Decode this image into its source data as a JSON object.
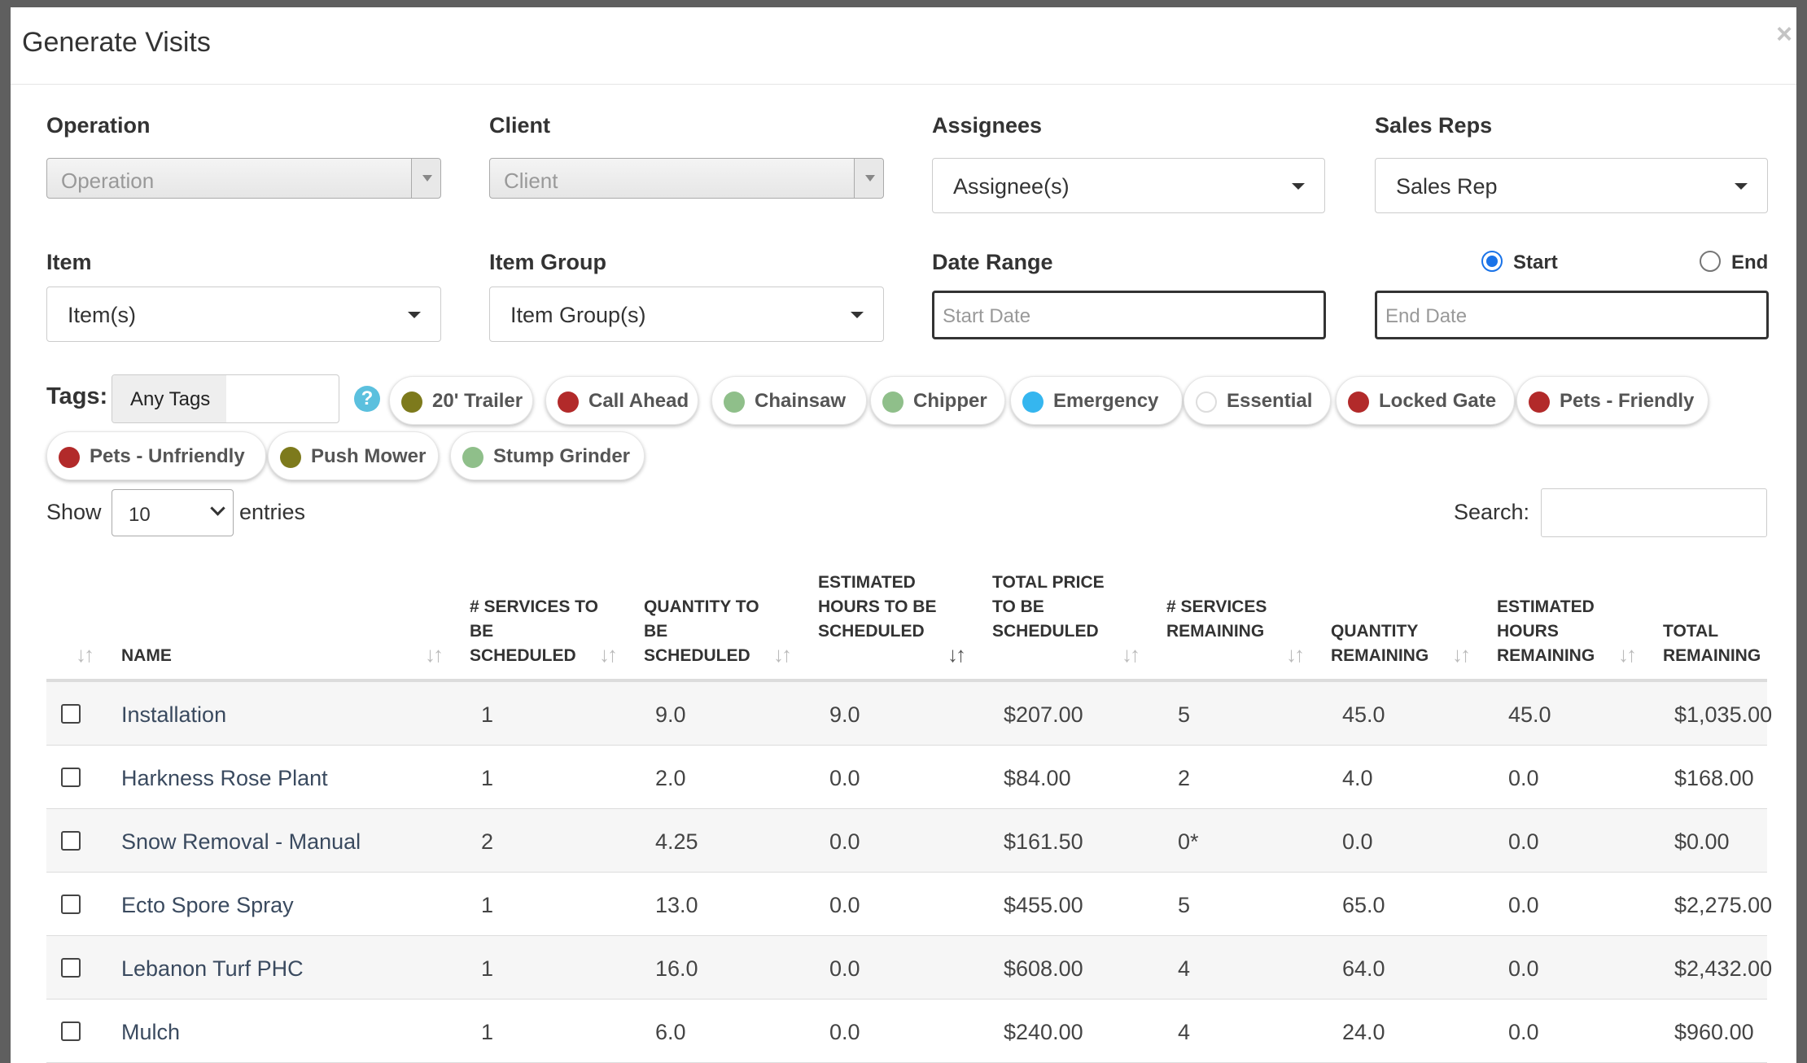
{
  "modal": {
    "title": "Generate Visits",
    "close_glyph": "×"
  },
  "filters": {
    "operation": {
      "label": "Operation",
      "placeholder": "Operation"
    },
    "client": {
      "label": "Client",
      "placeholder": "Client"
    },
    "assignees": {
      "label": "Assignees",
      "value": "Assignee(s)"
    },
    "sales_reps": {
      "label": "Sales Reps",
      "value": "Sales Rep"
    },
    "item": {
      "label": "Item",
      "value": "Item(s)"
    },
    "item_group": {
      "label": "Item Group",
      "value": "Item Group(s)"
    },
    "date_range": {
      "label": "Date Range",
      "start_placeholder": "Start Date",
      "end_placeholder": "End Date"
    },
    "radio": {
      "start_label": "Start",
      "end_label": "End",
      "selected": "Start"
    }
  },
  "tags": {
    "label": "Tags:",
    "mode": "Any Tags",
    "help_glyph": "?",
    "items": [
      {
        "name": "20' Trailer",
        "color": "#7d7a1c"
      },
      {
        "name": "Call Ahead",
        "color": "#b22a2a"
      },
      {
        "name": "Chainsaw",
        "color": "#8fbf8a"
      },
      {
        "name": "Chipper",
        "color": "#8fbf8a"
      },
      {
        "name": "Emergency",
        "color": "#35b6ef"
      },
      {
        "name": "Essential",
        "color": "#ffffff"
      },
      {
        "name": "Locked Gate",
        "color": "#b22a2a"
      },
      {
        "name": "Pets - Friendly",
        "color": "#b22a2a"
      },
      {
        "name": "Pets - Unfriendly",
        "color": "#b22a2a"
      },
      {
        "name": "Push Mower",
        "color": "#7d7a1c"
      },
      {
        "name": "Stump Grinder",
        "color": "#8fbf8a"
      }
    ]
  },
  "table_controls": {
    "show_label": "Show",
    "entries_value": "10",
    "entries_label": "entries",
    "search_label": "Search:"
  },
  "table": {
    "sort_glyph": "↓↑",
    "columns": [
      "",
      "Name",
      "# Services to be Scheduled",
      "Quantity to be Scheduled",
      "Estimated Hours to be Scheduled",
      "Total Price to be Scheduled",
      "# Services Remaining",
      "Quantity Remaining",
      "Estimated Hours Remaining",
      "Total Remaining"
    ],
    "rows": [
      {
        "name": "Installation",
        "services": "1",
        "qty": "9.0",
        "hours": "9.0",
        "price": "$207.00",
        "svc_rem": "5",
        "qty_rem": "45.0",
        "hrs_rem": "45.0",
        "total_rem": "$1,035.00"
      },
      {
        "name": "Harkness Rose Plant",
        "services": "1",
        "qty": "2.0",
        "hours": "0.0",
        "price": "$84.00",
        "svc_rem": "2",
        "qty_rem": "4.0",
        "hrs_rem": "0.0",
        "total_rem": "$168.00"
      },
      {
        "name": "Snow Removal - Manual",
        "services": "2",
        "qty": "4.25",
        "hours": "0.0",
        "price": "$161.50",
        "svc_rem": "0*",
        "qty_rem": "0.0",
        "hrs_rem": "0.0",
        "total_rem": "$0.00"
      },
      {
        "name": "Ecto Spore Spray",
        "services": "1",
        "qty": "13.0",
        "hours": "0.0",
        "price": "$455.00",
        "svc_rem": "5",
        "qty_rem": "65.0",
        "hrs_rem": "0.0",
        "total_rem": "$2,275.00"
      },
      {
        "name": "Lebanon Turf PHC",
        "services": "1",
        "qty": "16.0",
        "hours": "0.0",
        "price": "$608.00",
        "svc_rem": "4",
        "qty_rem": "64.0",
        "hrs_rem": "0.0",
        "total_rem": "$2,432.00"
      },
      {
        "name": "Mulch",
        "services": "1",
        "qty": "6.0",
        "hours": "0.0",
        "price": "$240.00",
        "svc_rem": "4",
        "qty_rem": "24.0",
        "hrs_rem": "0.0",
        "total_rem": "$960.00"
      }
    ]
  }
}
